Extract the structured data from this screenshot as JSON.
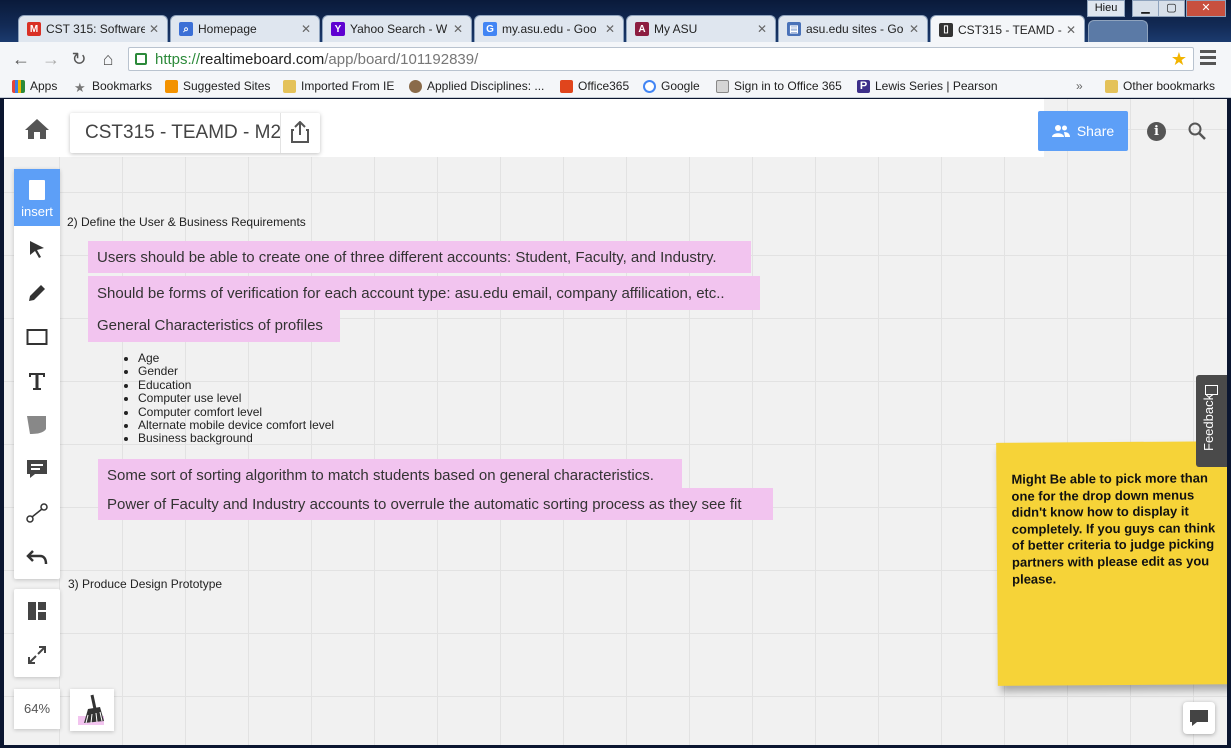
{
  "browser": {
    "tabs": [
      {
        "title": "CST 315: Software",
        "favicon": "gmail-icon",
        "color": "#d93025"
      },
      {
        "title": "Homepage",
        "favicon": "search-icon",
        "color": "#3b6fd6"
      },
      {
        "title": "Yahoo Search - W",
        "favicon": "yahoo-icon",
        "color": "#5f01d1"
      },
      {
        "title": "my.asu.edu - Goo",
        "favicon": "google-icon",
        "color": "#4285f4"
      },
      {
        "title": "My ASU",
        "favicon": "asu-icon",
        "color": "#8c1d40"
      },
      {
        "title": "asu.edu sites - Go",
        "favicon": "sites-icon",
        "color": "#4a72b8"
      },
      {
        "title": "CST315 - TEAMD -",
        "favicon": "board-icon",
        "color": "#333333"
      }
    ],
    "user": "Hieu",
    "url_scheme": "https://",
    "url_host": "realtimeboard.com",
    "url_path": "/app/board/101192839/",
    "bookmarks": [
      {
        "label": "Apps"
      },
      {
        "label": "Bookmarks"
      },
      {
        "label": "Suggested Sites"
      },
      {
        "label": "Imported From IE"
      },
      {
        "label": "Applied Disciplines: ..."
      },
      {
        "label": "Office365"
      },
      {
        "label": "Google"
      },
      {
        "label": "Sign in to Office 365"
      },
      {
        "label": "Lewis Series | Pearson"
      },
      {
        "label": "Other bookmarks"
      }
    ]
  },
  "board": {
    "title": "CST315 - TEAMD - M2",
    "share_label": "Share",
    "insert_label": "insert",
    "zoom": "64%",
    "feedback_label": "Feedback"
  },
  "canvas": {
    "section2_heading": "2) Define the User & Business Requirements",
    "requirement_1": "Users should be able to create one of three different accounts: Student, Faculty, and Industry.",
    "requirement_2": "Should be forms of verification for each account type: asu.edu email, company affilication, etc..",
    "profiles_heading": "General Characteristics of profiles",
    "profile_items": [
      "Age",
      "Gender",
      "Education",
      "Computer use level",
      "Computer comfort level",
      "Alternate mobile device comfort level",
      "Business background"
    ],
    "sorting_note": "Some sort of sorting algorithm to match students based on general characteristics.",
    "override_note": "Power of Faculty and Industry accounts to overrule the automatic sorting process as they see fit",
    "section3_heading": "3) Produce Design Prototype",
    "sticky_note": "Might Be able to pick more than\none for the drop down menus\ndidn't know how to display it\ncompletely. If you guys can think\nof better criteria to judge picking\npartners with please edit as you\nplease."
  },
  "colors": {
    "highlight": "#f2c4ef",
    "sticky": "#f6d338",
    "accent": "#5d9ff7"
  }
}
